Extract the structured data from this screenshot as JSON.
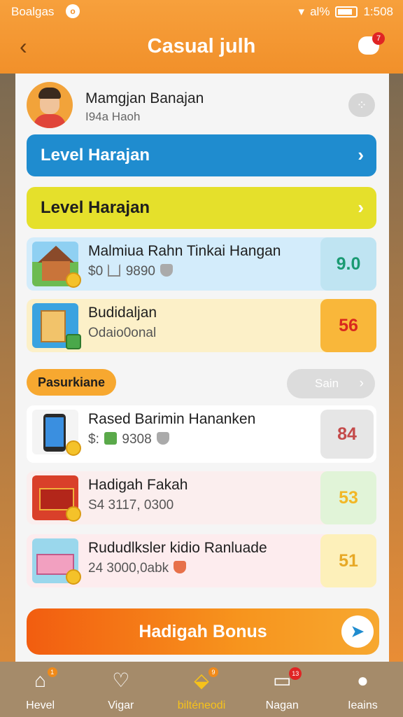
{
  "status_bar": {
    "carrier": "Boalgas",
    "notif": "o",
    "percent": "al%",
    "time": "1:508"
  },
  "header": {
    "title": "Casual julh",
    "back_icon": "chevron-left-icon",
    "chat_badge": "7"
  },
  "profile": {
    "name": "Mamgjan Banajan",
    "subtitle": "I94a Haoh",
    "more_icon": "more-icon"
  },
  "levels": [
    {
      "label": "Level Harajan",
      "color": "#1f8ccf"
    },
    {
      "label": "Level Harajan",
      "color": "#e5e02b"
    }
  ],
  "top_items": [
    {
      "title": "Malmiua Rahn Tinkai Hangan",
      "sub_prefix": "$0",
      "sub_value": "9890",
      "value": "9.0"
    },
    {
      "title": "Budidaljan",
      "sub": "Odaio0onal",
      "value": "56"
    }
  ],
  "section": {
    "tag": "Pasurkiane",
    "see_all": "Sain"
  },
  "list_items": [
    {
      "title": "Rased Barimin Hananken",
      "sub_prefix": "$:",
      "sub_value": "9308",
      "value": "84"
    },
    {
      "title": "Hadigah Fakah",
      "sub": "S4 3117, 0300",
      "value": "53"
    },
    {
      "title": "Rududlksler kidio Ranluade",
      "sub": "24 3000,0abk",
      "value": "51"
    }
  ],
  "cta": {
    "label": "Hadigah Bonus"
  },
  "nav": [
    {
      "label": "Hevel",
      "icon": "home-icon",
      "badge": "1"
    },
    {
      "label": "Vigar",
      "icon": "heart-icon"
    },
    {
      "label": "bilténeodi",
      "icon": "gift-icon",
      "badge": "9",
      "active": true
    },
    {
      "label": "Nagan",
      "icon": "tablet-icon",
      "badge": "13"
    },
    {
      "label": "Ieains",
      "icon": "profile-icon"
    }
  ]
}
